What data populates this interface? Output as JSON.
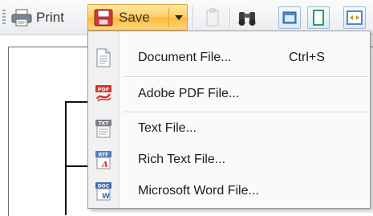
{
  "toolbar": {
    "print_label": "Print",
    "save_label": "Save"
  },
  "menu": {
    "items": [
      {
        "label": "Document File...",
        "shortcut": "Ctrl+S",
        "icon": "document-icon"
      },
      {
        "label": "Adobe PDF File...",
        "icon": "pdf-file-icon"
      },
      {
        "label": "Text File...",
        "icon": "txt-file-icon"
      },
      {
        "label": "Rich Text File...",
        "icon": "rtf-file-icon"
      },
      {
        "label": "Microsoft Word File...",
        "icon": "doc-file-icon"
      }
    ]
  },
  "colors": {
    "save_highlight": "#ffcf63",
    "menu_border": "#979797",
    "toolbar_bg": "#e9ecef"
  }
}
